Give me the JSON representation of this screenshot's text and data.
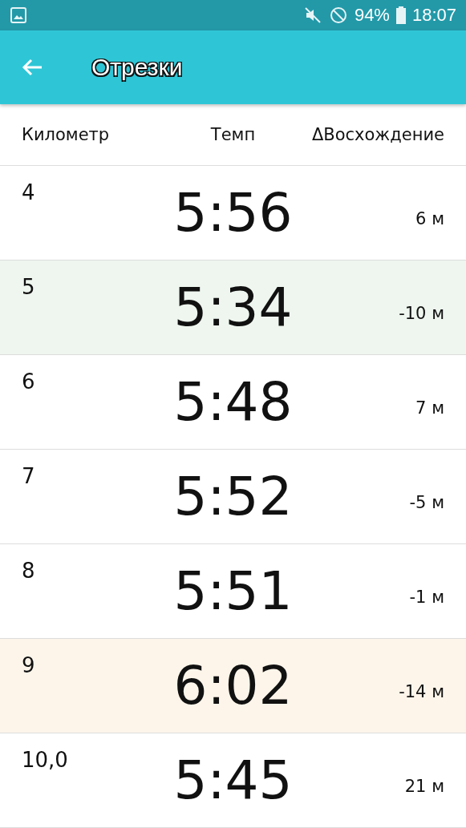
{
  "status_bar": {
    "battery": "94%",
    "time": "18:07"
  },
  "toolbar": {
    "title": "Отрезки"
  },
  "table": {
    "columns": [
      "Километр",
      "Темп",
      "ΔВосхождение"
    ],
    "rows": [
      {
        "km": "4",
        "pace": "5:56",
        "elevation": "6 м",
        "color": "#ffffff"
      },
      {
        "km": "5",
        "pace": "5:34",
        "elevation": "-10 м",
        "color": "#eef6ef"
      },
      {
        "km": "6",
        "pace": "5:48",
        "elevation": "7 м",
        "color": "#ffffff"
      },
      {
        "km": "7",
        "pace": "5:52",
        "elevation": "-5 м",
        "color": "#ffffff"
      },
      {
        "km": "8",
        "pace": "5:51",
        "elevation": "-1 м",
        "color": "#ffffff"
      },
      {
        "km": "9",
        "pace": "6:02",
        "elevation": "-14 м",
        "color": "#fdf5ea"
      },
      {
        "km": "10,0",
        "pace": "5:45",
        "elevation": "21 м",
        "color": "#ffffff"
      }
    ]
  }
}
